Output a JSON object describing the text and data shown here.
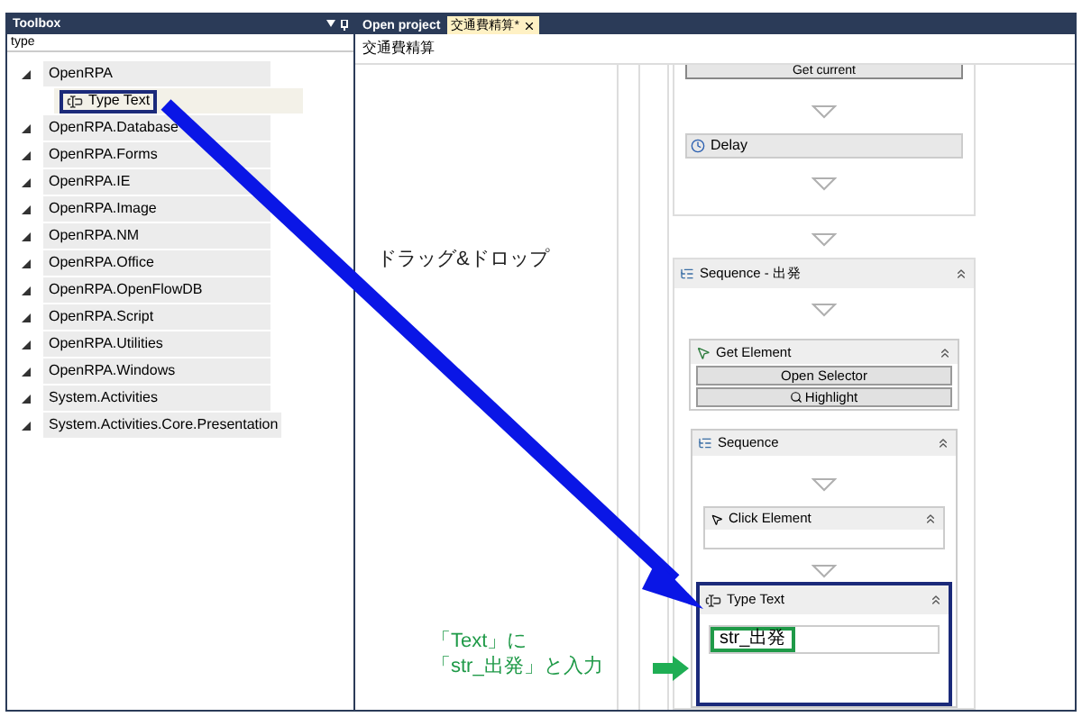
{
  "toolbox": {
    "title": "Toolbox",
    "search": {
      "value": "type"
    },
    "groups": [
      {
        "label": "OpenRPA",
        "expanded": true,
        "children": [
          {
            "label": "Type Text",
            "selected": true
          }
        ]
      },
      {
        "label": "OpenRPA.Database",
        "expanded": true
      },
      {
        "label": "OpenRPA.Forms",
        "expanded": true
      },
      {
        "label": "OpenRPA.IE",
        "expanded": true
      },
      {
        "label": "OpenRPA.Image",
        "expanded": true
      },
      {
        "label": "OpenRPA.NM",
        "expanded": true
      },
      {
        "label": "OpenRPA.Office",
        "expanded": true
      },
      {
        "label": "OpenRPA.OpenFlowDB",
        "expanded": true
      },
      {
        "label": "OpenRPA.Script",
        "expanded": true
      },
      {
        "label": "OpenRPA.Utilities",
        "expanded": true
      },
      {
        "label": "OpenRPA.Windows",
        "expanded": true
      },
      {
        "label": "System.Activities",
        "expanded": true
      },
      {
        "label": "System.Activities.Core.Presentation",
        "expanded": true
      }
    ]
  },
  "tabs": [
    {
      "label": "Open project",
      "selected": false
    },
    {
      "label": "交通費精算*",
      "selected": true
    }
  ],
  "document_title": "交通費精算",
  "workflow": {
    "top_button": "Get current",
    "delay": "Delay",
    "sequence": {
      "title": "Sequence - 出発",
      "get_element": {
        "title": "Get Element",
        "buttons": [
          "Open Selector",
          "Highlight"
        ]
      },
      "inner_sequence": {
        "title": "Sequence",
        "click_element": "Click Element",
        "type_text": {
          "title": "Type Text",
          "value": "str_出発"
        }
      }
    }
  },
  "annotations": {
    "drag_drop": "ドラッグ&ドロップ",
    "instruction": [
      "「Text」に",
      "「str_出発」と入力"
    ]
  }
}
